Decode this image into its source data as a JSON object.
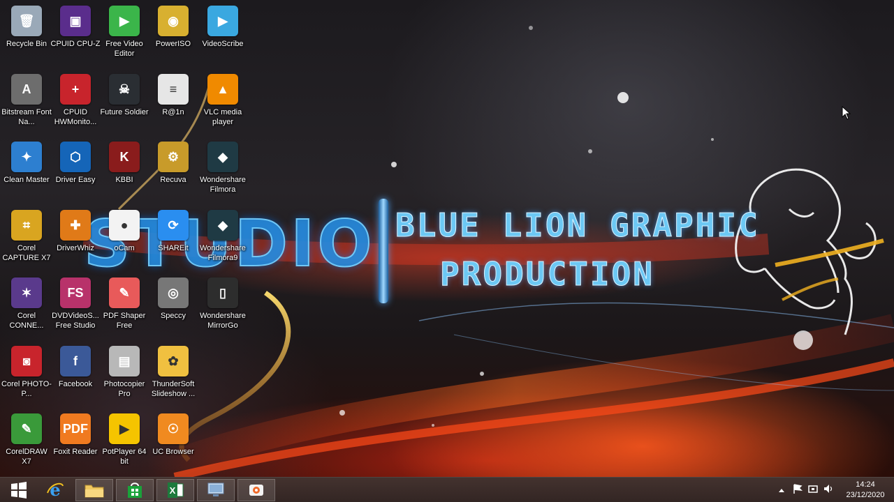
{
  "desktop": {
    "icons": [
      {
        "label": "Recycle Bin",
        "icon": "recycle-bin-icon",
        "color": "#9aa9b8",
        "glyph": "🗑"
      },
      {
        "label": "CPUID CPU-Z",
        "icon": "cpu-z-icon",
        "color": "#5a2d8c",
        "glyph": "▣"
      },
      {
        "label": "Free Video Editor",
        "icon": "video-editor-icon",
        "color": "#3bb54a",
        "glyph": "▶"
      },
      {
        "label": "PowerISO",
        "icon": "poweriso-icon",
        "color": "#d8b030",
        "glyph": "◉"
      },
      {
        "label": "VideoScribe",
        "icon": "videoscribe-icon",
        "color": "#3aa8e0",
        "glyph": "▶"
      },
      {
        "label": "Bitstream Font Na...",
        "icon": "font-navigator-icon",
        "color": "#6d6d6d",
        "glyph": "A"
      },
      {
        "label": "CPUID HWMonito...",
        "icon": "hwmonitor-icon",
        "color": "#c8242c",
        "glyph": "+"
      },
      {
        "label": "Future Soldier",
        "icon": "future-soldier-icon",
        "color": "#2a2e33",
        "glyph": "☠"
      },
      {
        "label": "R@1n",
        "icon": "file-icon",
        "color": "#e6e6e6",
        "glyph": "≡"
      },
      {
        "label": "VLC media player",
        "icon": "vlc-icon",
        "color": "#f08a00",
        "glyph": "▲"
      },
      {
        "label": "Clean Master",
        "icon": "clean-master-icon",
        "color": "#2d7fd0",
        "glyph": "✦"
      },
      {
        "label": "Driver Easy",
        "icon": "driver-easy-icon",
        "color": "#1565b8",
        "glyph": "⬡"
      },
      {
        "label": "KBBI",
        "icon": "kbbi-book-icon",
        "color": "#8a1c1c",
        "glyph": "K"
      },
      {
        "label": "Recuva",
        "icon": "recuva-icon",
        "color": "#c89b2a",
        "glyph": "⚙"
      },
      {
        "label": "Wondershare Filmora",
        "icon": "filmora-icon",
        "color": "#1f3a44",
        "glyph": "◆"
      },
      {
        "label": "Corel CAPTURE X7",
        "icon": "corel-capture-icon",
        "color": "#d9a520",
        "glyph": "⌗"
      },
      {
        "label": "DriverWhiz",
        "icon": "driverwhiz-icon",
        "color": "#e07a18",
        "glyph": "✚"
      },
      {
        "label": "oCam",
        "icon": "ocam-icon",
        "color": "#f3f3f3",
        "glyph": "●"
      },
      {
        "label": "SHAREit",
        "icon": "shareit-icon",
        "color": "#2a8ef0",
        "glyph": "⟳"
      },
      {
        "label": "Wondershare Filmora9",
        "icon": "filmora9-icon",
        "color": "#1f3a44",
        "glyph": "◆"
      },
      {
        "label": "Corel CONNE...",
        "icon": "corel-connect-icon",
        "color": "#5a3a8c",
        "glyph": "✶"
      },
      {
        "label": "DVDVideoS... Free Studio",
        "icon": "dvdvideosoft-icon",
        "color": "#b8326a",
        "glyph": "FS"
      },
      {
        "label": "PDF Shaper Free",
        "icon": "pdf-shaper-icon",
        "color": "#e85a5a",
        "glyph": "✎"
      },
      {
        "label": "Speccy",
        "icon": "speccy-icon",
        "color": "#777777",
        "glyph": "◎"
      },
      {
        "label": "Wondershare MirrorGo",
        "icon": "mirrorgo-icon",
        "color": "#2d2d2d",
        "glyph": "▯"
      },
      {
        "label": "Corel PHOTO-P...",
        "icon": "corel-photo-paint-icon",
        "color": "#c8242c",
        "glyph": "◙"
      },
      {
        "label": "Facebook",
        "icon": "facebook-icon",
        "color": "#3b5998",
        "glyph": "f"
      },
      {
        "label": "Photocopier Pro",
        "icon": "photocopier-icon",
        "color": "#b8b8b8",
        "glyph": "▤"
      },
      {
        "label": "ThunderSoft Slideshow ...",
        "icon": "thundersoft-icon",
        "color": "#f0c040",
        "glyph": "✿"
      },
      {
        "label": "CorelDRAW X7",
        "icon": "coreldraw-icon",
        "color": "#3a9a3a",
        "glyph": "✎"
      },
      {
        "label": "Foxit Reader",
        "icon": "foxit-reader-icon",
        "color": "#f07a20",
        "glyph": "PDF"
      },
      {
        "label": "PotPlayer 64 bit",
        "icon": "potplayer-icon",
        "color": "#f5c400",
        "glyph": "▶"
      },
      {
        "label": "UC Browser",
        "icon": "uc-browser-icon",
        "color": "#f08a20",
        "glyph": "☉"
      }
    ]
  },
  "wallpaper": {
    "studio": "STUDIO",
    "line1": "BLUE LION GRAPHIC",
    "line2": "PRODUCTION"
  },
  "taskbar": {
    "buttons": [
      {
        "name": "start-button",
        "icon": "windows-logo-icon",
        "color": "#ffffff"
      },
      {
        "name": "internet-explorer-button",
        "icon": "internet-explorer-icon",
        "color": "#3aa0f0"
      },
      {
        "name": "file-explorer-button",
        "icon": "folder-icon",
        "color": "#f0c860"
      },
      {
        "name": "store-button",
        "icon": "store-icon",
        "color": "#1aa23a"
      },
      {
        "name": "excel-button",
        "icon": "excel-icon",
        "color": "#1d7a3c"
      },
      {
        "name": "remote-app-button",
        "icon": "monitor-icon",
        "color": "#8ab0d8"
      },
      {
        "name": "ocam-taskbar-button",
        "icon": "ocam-icon",
        "color": "#f06a2a"
      }
    ],
    "clock": {
      "time": "14:24",
      "date": "23/12/2020"
    }
  }
}
